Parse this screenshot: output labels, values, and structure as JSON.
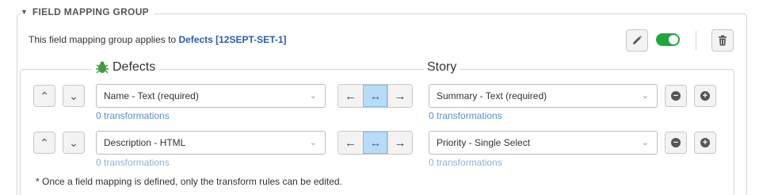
{
  "group": {
    "title": "FIELD MAPPING GROUP",
    "applies_prefix": "This field mapping group applies to ",
    "applies_link": "Defects [12SEPT-SET-1]"
  },
  "columns": {
    "source_title": "Defects",
    "target_title": "Story"
  },
  "rows": [
    {
      "source_field": "Name - Text (required)",
      "target_field": "Summary - Text (required)",
      "source_transformations": "0 transformations",
      "target_transformations": "0 transformations",
      "direction": "both"
    },
    {
      "source_field": "Description - HTML",
      "target_field": "Priority - Single Select",
      "source_transformations": "0 transformations",
      "target_transformations": "0 transformations",
      "direction": "both"
    }
  ],
  "note": "* Once a field mapping is defined, only the transform rules can be edited.",
  "icons": {
    "caret": "▼",
    "up": "⌃",
    "down": "⌄",
    "left": "←",
    "both": "↔",
    "right": "→",
    "remove": "−",
    "add": "+",
    "chev": "⌄"
  },
  "colors": {
    "link": "#2a5db0",
    "toggle_on": "#22a63a",
    "active_direction": "#b9dcf6",
    "transformations_link": "#5b8ed0"
  }
}
